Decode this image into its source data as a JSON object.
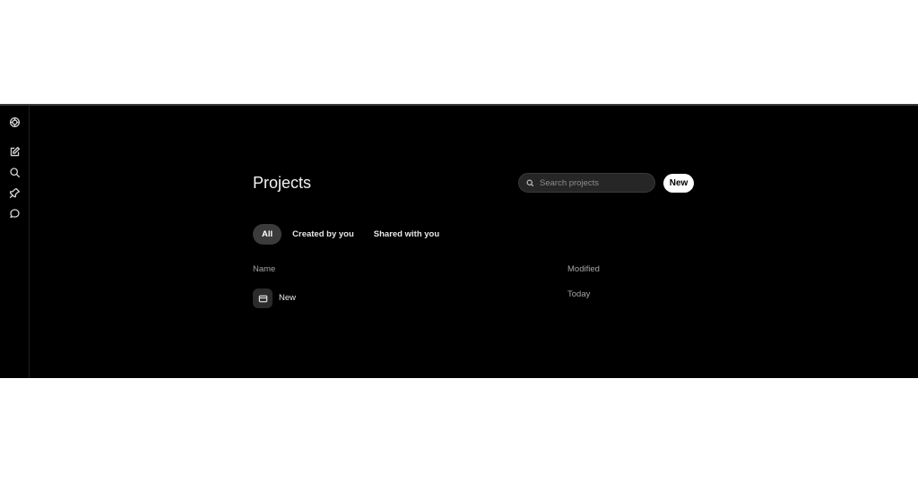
{
  "sidebar": {
    "items": [
      {
        "icon": "logo-icon"
      },
      {
        "icon": "new-chat-icon"
      },
      {
        "icon": "search-icon"
      },
      {
        "icon": "pin-icon"
      },
      {
        "icon": "chat-icon"
      }
    ]
  },
  "header": {
    "title": "Projects",
    "search_placeholder": "Search projects",
    "new_label": "New"
  },
  "tabs": [
    {
      "label": "All",
      "active": true
    },
    {
      "label": "Created by you",
      "active": false
    },
    {
      "label": "Shared with you",
      "active": false
    }
  ],
  "table": {
    "columns": [
      "Name",
      "Modified"
    ],
    "rows": [
      {
        "name": "New",
        "modified": "Today",
        "icon": "folder-icon"
      }
    ]
  },
  "colors": {
    "background": "#000000",
    "page": "#ffffff",
    "active_tab": "#3b3b3b",
    "muted_text": "#a6a6a6"
  }
}
